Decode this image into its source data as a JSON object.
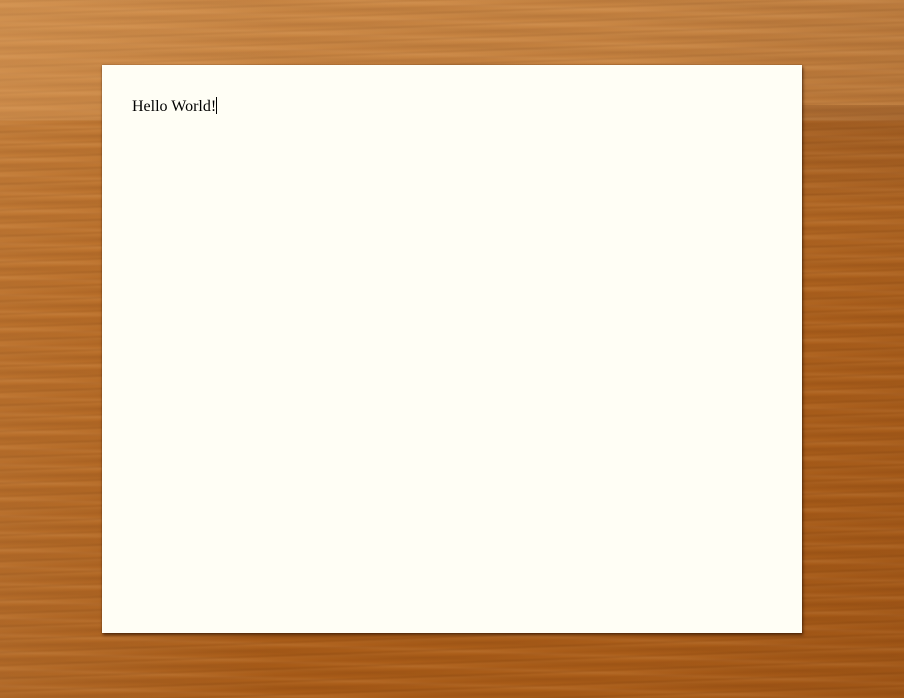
{
  "editor": {
    "text": "Hello World!"
  }
}
